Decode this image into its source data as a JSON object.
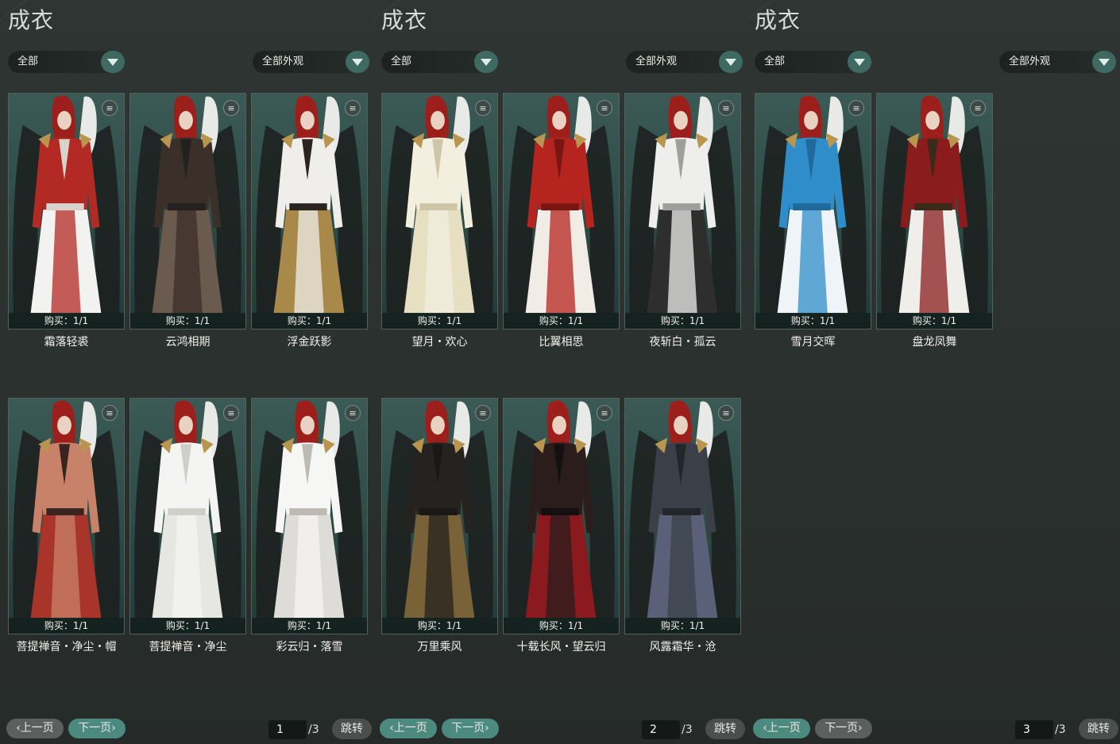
{
  "panels": [
    {
      "title": "成衣",
      "filter_category": "全部",
      "filter_appearance": "全部外观",
      "items": [
        {
          "purchase": "购买：1/1",
          "name": "霜落轻裘",
          "palette": [
            "#b32a24",
            "#f2f2f0",
            "#d8d4cc"
          ]
        },
        {
          "purchase": "购买：1/1",
          "name": "云鸿相期",
          "palette": [
            "#3b2f2a",
            "#6b5a4e",
            "#24201e"
          ]
        },
        {
          "purchase": "购买：1/1",
          "name": "浮金跃影",
          "palette": [
            "#efeeea",
            "#a8894a",
            "#2a2420"
          ]
        },
        {
          "purchase": "购买：1/1",
          "name": "菩提禅音・净尘・帽",
          "palette": [
            "#c9826a",
            "#a8342a",
            "#3a2420"
          ]
        },
        {
          "purchase": "购买：1/1",
          "name": "菩提禅音・净尘",
          "palette": [
            "#f4f4f2",
            "#e6e6e2",
            "#cfcfca"
          ]
        },
        {
          "purchase": "购买：1/1",
          "name": "彩云归・落雪",
          "palette": [
            "#f6f6f4",
            "#dedcd8",
            "#bdbab4"
          ]
        }
      ],
      "pagination": {
        "prev": "上一页",
        "next": "下一页",
        "page": "1",
        "total": "/3",
        "jump": "跳转",
        "active": "next"
      }
    },
    {
      "title": "成衣",
      "filter_category": "全部",
      "filter_appearance": "全部外观",
      "items": [
        {
          "purchase": "购买：1/1",
          "name": "望月・欢心",
          "palette": [
            "#f3efdf",
            "#e6dfc2",
            "#cfc6a8"
          ]
        },
        {
          "purchase": "购买：1/1",
          "name": "比翼相思",
          "palette": [
            "#b5241e",
            "#f2ece6",
            "#7a1612"
          ]
        },
        {
          "purchase": "购买：1/1",
          "name": "夜斩白・孤云",
          "palette": [
            "#eeeeec",
            "#2e2e2e",
            "#9e9e9a"
          ]
        },
        {
          "purchase": "购买：1/1",
          "name": "万里乘风",
          "palette": [
            "#26221f",
            "#7a6238",
            "#1a1816"
          ]
        },
        {
          "purchase": "购买：1/1",
          "name": "十载长风・望云归",
          "palette": [
            "#2a1d1c",
            "#8a1a1e",
            "#141010"
          ]
        },
        {
          "purchase": "购买：1/1",
          "name": "风露霜华・沧",
          "palette": [
            "#3b4048",
            "#5a6078",
            "#22252a"
          ]
        }
      ],
      "pagination": {
        "prev": "上一页",
        "next": "下一页",
        "page": "2",
        "total": "/3",
        "jump": "跳转",
        "active": "both"
      }
    },
    {
      "title": "成衣",
      "filter_category": "全部",
      "filter_appearance": "全部外观",
      "items": [
        {
          "purchase": "购买：1/1",
          "name": "雪月交晖",
          "palette": [
            "#2f8ec9",
            "#eef4f8",
            "#1f6a9a"
          ]
        },
        {
          "purchase": "购买：1/1",
          "name": "盘龙凤舞",
          "palette": [
            "#8a1c1e",
            "#efeeea",
            "#3a2a1a"
          ]
        }
      ],
      "pagination": {
        "prev": "上一页",
        "next": "下一页",
        "page": "3",
        "total": "/3",
        "jump": "跳转",
        "active": "prev"
      }
    }
  ]
}
